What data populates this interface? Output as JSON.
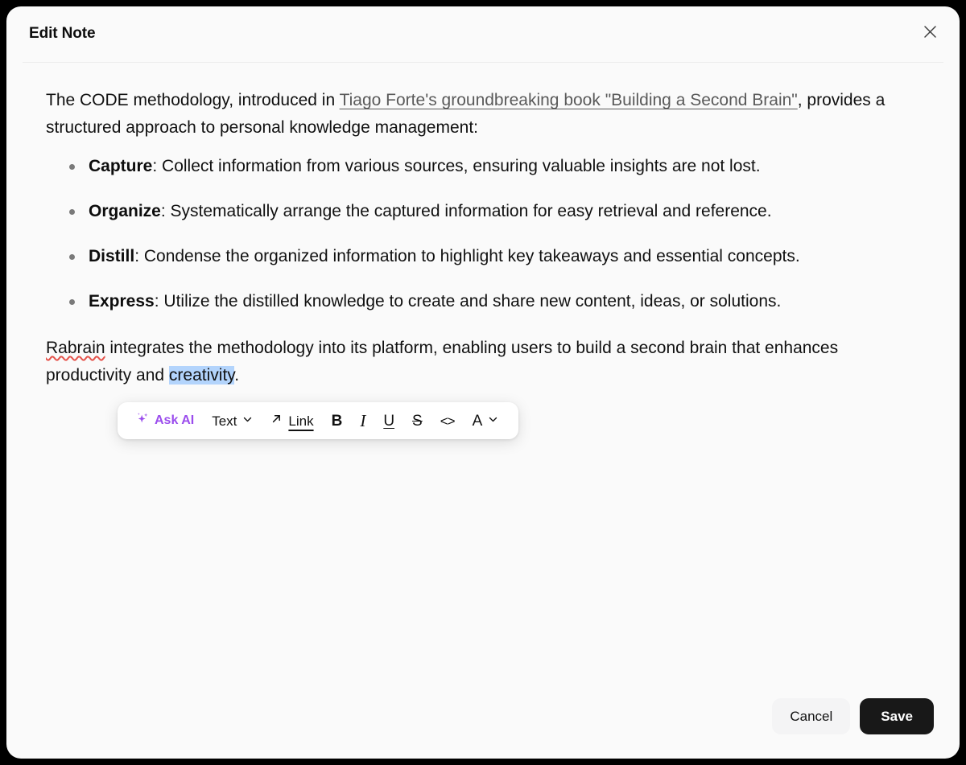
{
  "modal": {
    "title": "Edit Note",
    "close_icon": "close-icon"
  },
  "editor": {
    "intro": {
      "before_link": "The CODE methodology, introduced in ",
      "link_text": "Tiago Forte's groundbreaking book \"Building a Second Brain\"",
      "after_link": ", provides a structured approach to personal knowledge management:"
    },
    "bullets": [
      {
        "term": "Capture",
        "text": ": Collect information from various sources, ensuring valuable insights are not lost."
      },
      {
        "term": "Organize",
        "text": ": Systematically arrange the captured information for easy retrieval and reference."
      },
      {
        "term": "Distill",
        "text": ": Condense the organized information to highlight key takeaways and essential concepts."
      },
      {
        "term": "Express",
        "text": ": Utilize the distilled knowledge to create and share new content, ideas, or solutions."
      }
    ],
    "final_paragraph": {
      "misspelled_word": "Rabrain",
      "middle": " integrates the methodology into its platform, enabling users to build a second brain that enhances productivity and ",
      "selected_word": "creativity",
      "trailing": "."
    }
  },
  "toolbar": {
    "ask_ai": "Ask AI",
    "text_style": "Text",
    "link": "Link",
    "bold": "B",
    "italic": "I",
    "underline": "U",
    "strikethrough": "S",
    "code": "<>",
    "color": "A",
    "chevron": "chevron-down-icon"
  },
  "footer": {
    "cancel_label": "Cancel",
    "save_label": "Save"
  },
  "colors": {
    "accent_ai": "#9b4ded",
    "selection": "#b3d4fc",
    "spellcheck": "#e5534b",
    "save_bg": "#181818",
    "modal_bg": "#fafafa",
    "page_bg": "#000000"
  }
}
